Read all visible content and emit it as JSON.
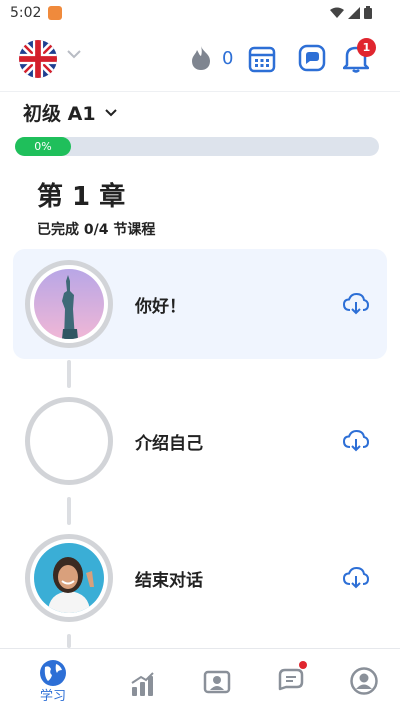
{
  "status_bar": {
    "time": "5:02",
    "icons": [
      "app-notification-icon",
      "wifi-icon",
      "signal-icon",
      "battery-icon"
    ]
  },
  "header": {
    "language_flag": "uk-flag-icon",
    "streak_count": "0",
    "notification_badge": "1",
    "colors": {
      "accent": "#2d6fd6",
      "badge": "#e0262f"
    }
  },
  "level": {
    "label": "初级 A1"
  },
  "progress": {
    "percent_label": "0%",
    "fraction": 0,
    "fill_color": "#1fbf5b"
  },
  "chapter": {
    "title": "第 1 章",
    "progress_text": "已完成 0/4 节课程"
  },
  "lessons": [
    {
      "title": "你好！",
      "thumbnail": "statue-of-liberty-image",
      "active": true
    },
    {
      "title": "介绍自己",
      "thumbnail": "empty",
      "active": false
    },
    {
      "title": "结束对话",
      "thumbnail": "smiling-woman-image",
      "active": false
    }
  ],
  "bottom_nav": {
    "items": [
      {
        "label": "学习",
        "icon": "globe-icon",
        "active": true
      },
      {
        "label": "",
        "icon": "chart-icon",
        "active": false
      },
      {
        "label": "",
        "icon": "profile-card-icon",
        "active": false
      },
      {
        "label": "",
        "icon": "chat-icon",
        "active": false
      },
      {
        "label": "",
        "icon": "user-icon",
        "active": false
      }
    ]
  }
}
